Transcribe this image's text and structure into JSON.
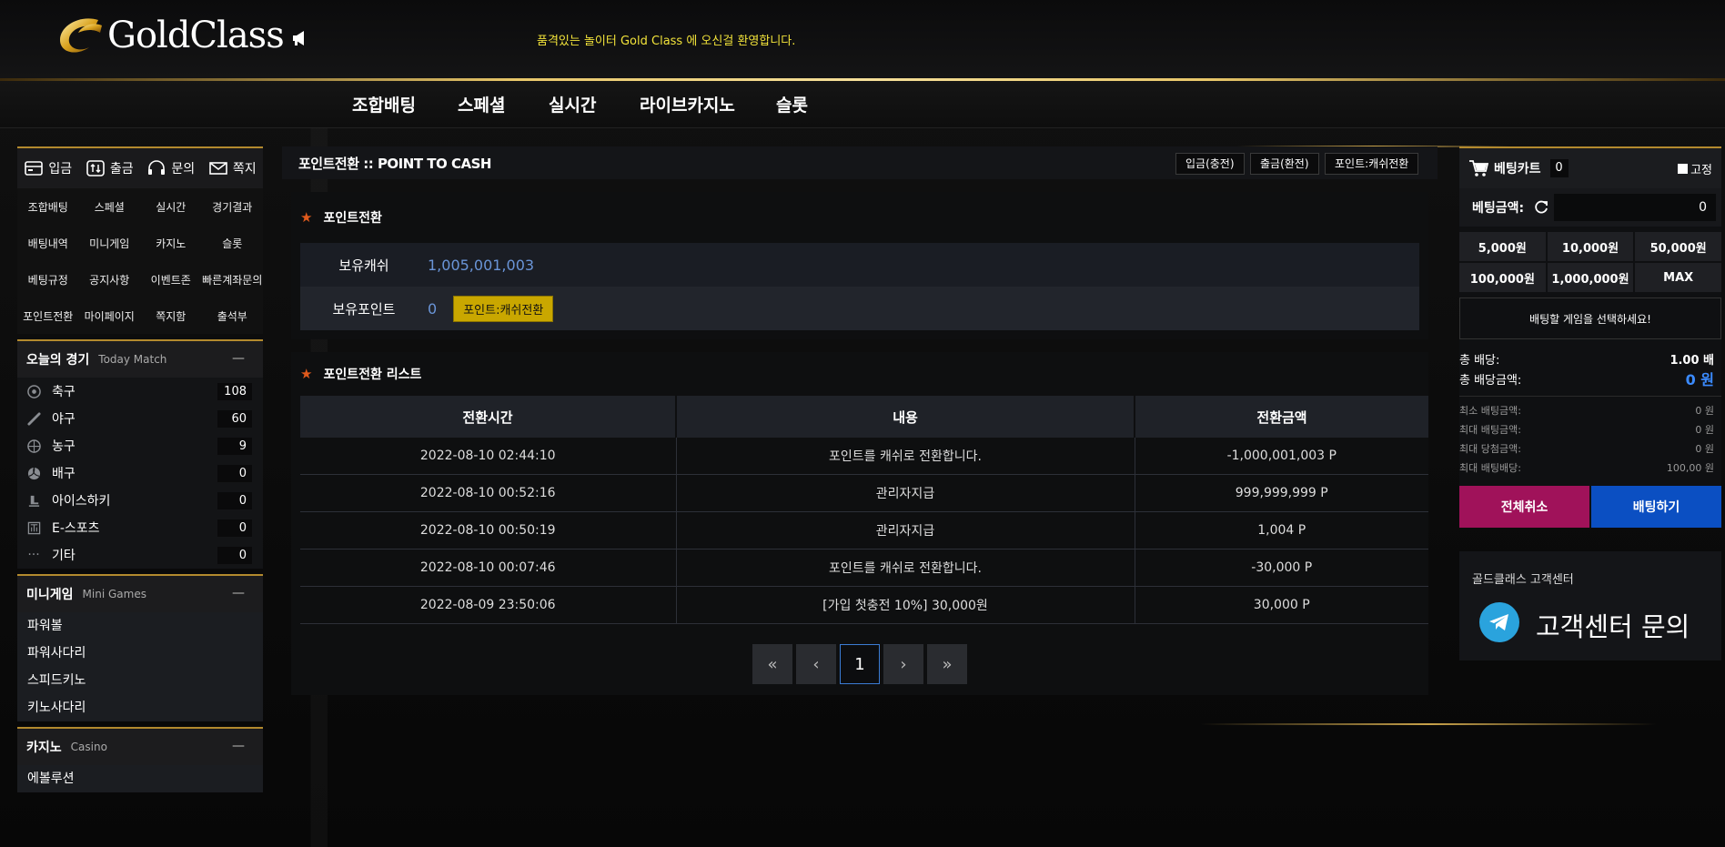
{
  "header": {
    "logo_text": "GoldClass",
    "marquee": "품격있는 놀이터 Gold Class 에 오신걸 환영합니다.",
    "nav": [
      "조합배팅",
      "스페셜",
      "실시간",
      "라이브카지노",
      "슬롯"
    ]
  },
  "sidebar": {
    "top_actions": [
      {
        "label": "입금",
        "icon": "deposit-icon"
      },
      {
        "label": "출금",
        "icon": "withdraw-icon"
      },
      {
        "label": "문의",
        "icon": "headset-icon"
      },
      {
        "label": "쪽지",
        "icon": "mail-icon"
      }
    ],
    "grid": [
      "조합배팅",
      "스페셜",
      "실시간",
      "경기결과",
      "배팅내역",
      "미니게임",
      "카지노",
      "슬롯",
      "베팅규정",
      "공지사항",
      "이벤트존",
      "빠른계좌문의",
      "포인트전환",
      "마이페이지",
      "쪽지함",
      "출석부"
    ],
    "today_match": {
      "title": "오늘의 경기",
      "subtitle": "Today Match",
      "sports": [
        {
          "name": "축구",
          "count": "108",
          "icon": "soccer-icon"
        },
        {
          "name": "야구",
          "count": "60",
          "icon": "baseball-bat-icon"
        },
        {
          "name": "농구",
          "count": "9",
          "icon": "basketball-icon"
        },
        {
          "name": "배구",
          "count": "0",
          "icon": "volleyball-icon"
        },
        {
          "name": "아이스하키",
          "count": "0",
          "icon": "skate-icon"
        },
        {
          "name": "E-스포츠",
          "count": "0",
          "icon": "esports-icon"
        },
        {
          "name": "기타",
          "count": "0",
          "icon": "more-icon"
        }
      ]
    },
    "mini_games": {
      "title": "미니게임",
      "subtitle": "Mini Games",
      "items": [
        "파워볼",
        "파워사다리",
        "스피드키노",
        "키노사다리"
      ]
    },
    "casino": {
      "title": "카지노",
      "subtitle": "Casino",
      "items": [
        "에볼루션"
      ]
    },
    "collapse_symbol": "—"
  },
  "main": {
    "title": "포인트전환 :: POINT TO CASH",
    "buttons": [
      "입금(충전)",
      "출금(환전)",
      "포인트:캐쉬전환"
    ],
    "convert_section": {
      "heading": "포인트전환",
      "cash_label": "보유캐쉬",
      "cash_value": "1,005,001,003",
      "point_label": "보유포인트",
      "point_value": "0",
      "convert_button": "포인트:캐쉬전환"
    },
    "list_section": {
      "heading": "포인트전환 리스트",
      "columns": [
        "전환시간",
        "내용",
        "전환금액"
      ],
      "rows": [
        [
          "2022-08-10 02:44:10",
          "포인트를 캐쉬로 전환합니다.",
          "-1,000,001,003 P"
        ],
        [
          "2022-08-10 00:52:16",
          "관리자지급",
          "999,999,999 P"
        ],
        [
          "2022-08-10 00:50:19",
          "관리자지급",
          "1,004 P"
        ],
        [
          "2022-08-10 00:07:46",
          "포인트를 캐쉬로 전환합니다.",
          "-30,000 P"
        ],
        [
          "2022-08-09 23:50:06",
          "[가입 첫충전 10%] 30,000원",
          "30,000 P"
        ]
      ]
    },
    "pagination": {
      "first": "«",
      "prev": "‹",
      "current": "1",
      "next": "›",
      "last": "»"
    }
  },
  "betslip": {
    "title": "베팅카트",
    "count": "0",
    "fix_label": "고정",
    "amount_label": "베팅금액:",
    "amount_value": "0",
    "quick_amounts": [
      "5,000원",
      "10,000원",
      "50,000원",
      "100,000원",
      "1,000,000원",
      "MAX"
    ],
    "select_game_msg": "배팅할 게임을 선택하세요!",
    "total_odds_label": "총 배당:",
    "total_odds_value": "1.00 배",
    "total_amount_label": "총 배당금액:",
    "total_amount_value": "0 원",
    "limits": [
      {
        "label": "최소 배팅금액:",
        "value": "0 원"
      },
      {
        "label": "최대 배팅금액:",
        "value": "0 원"
      },
      {
        "label": "최대 당첨금액:",
        "value": "0 원"
      },
      {
        "label": "최대 배팅배당:",
        "value": "100,00 원"
      }
    ],
    "cancel_all": "전체취소",
    "place_bet": "배팅하기",
    "colors": {
      "cancel": "#a0125a",
      "bet": "#0b4fc2"
    }
  },
  "customer_center": {
    "label": "골드클래스 고객센터",
    "text": "고객센터 문의"
  }
}
